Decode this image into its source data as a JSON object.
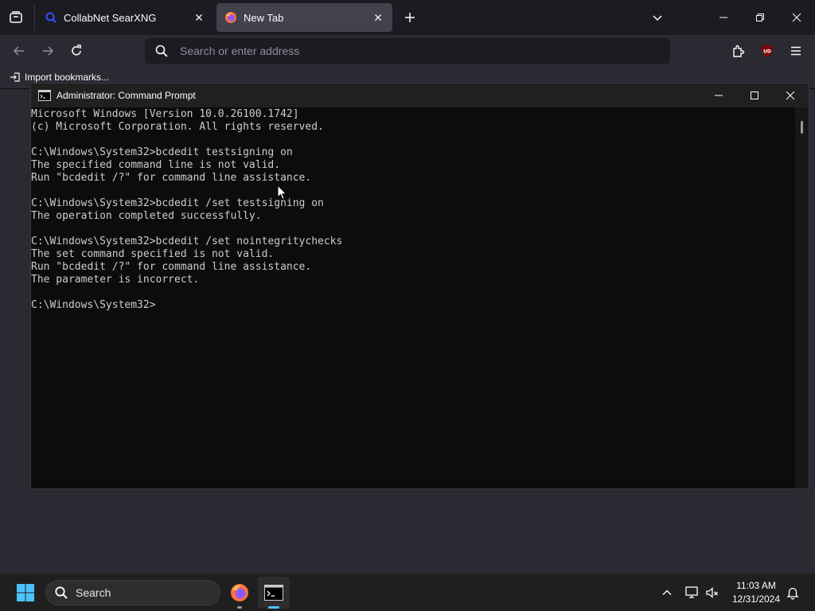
{
  "browser": {
    "tabs": [
      {
        "label": "CollabNet SearXNG",
        "active": false,
        "favicon": "searxng-icon"
      },
      {
        "label": "New Tab",
        "active": true,
        "favicon": "firefox-icon"
      }
    ],
    "urlbar": {
      "placeholder": "Search or enter address",
      "value": ""
    },
    "bookmarks": [
      {
        "label": "Import bookmarks..."
      }
    ],
    "extension_badge": "UD"
  },
  "cmd": {
    "title": "Administrator: Command Prompt",
    "lines": [
      "Microsoft Windows [Version 10.0.26100.1742]",
      "(c) Microsoft Corporation. All rights reserved.",
      "",
      "C:\\Windows\\System32>bcdedit testsigning on",
      "The specified command line is not valid.",
      "Run \"bcdedit /?\" for command line assistance.",
      "",
      "C:\\Windows\\System32>bcdedit /set testsigning on",
      "The operation completed successfully.",
      "",
      "C:\\Windows\\System32>bcdedit /set nointegritychecks",
      "The set command specified is not valid.",
      "Run \"bcdedit /?\" for command line assistance.",
      "The parameter is incorrect.",
      "",
      "C:\\Windows\\System32>"
    ]
  },
  "taskbar": {
    "search_label": "Search",
    "time": "11:03 AM",
    "date": "12/31/2024",
    "apps": [
      "firefox-icon",
      "command-prompt-icon"
    ]
  },
  "colors": {
    "firefox_bg": "#1c1b22",
    "toolbar_bg": "#2b2a33",
    "active_tab": "#42414d",
    "cmd_bg": "#0c0c0c",
    "cmd_text": "#cccccc",
    "taskbar_bg": "#1f1f1f",
    "windows_blue": "#4cc2ff"
  }
}
